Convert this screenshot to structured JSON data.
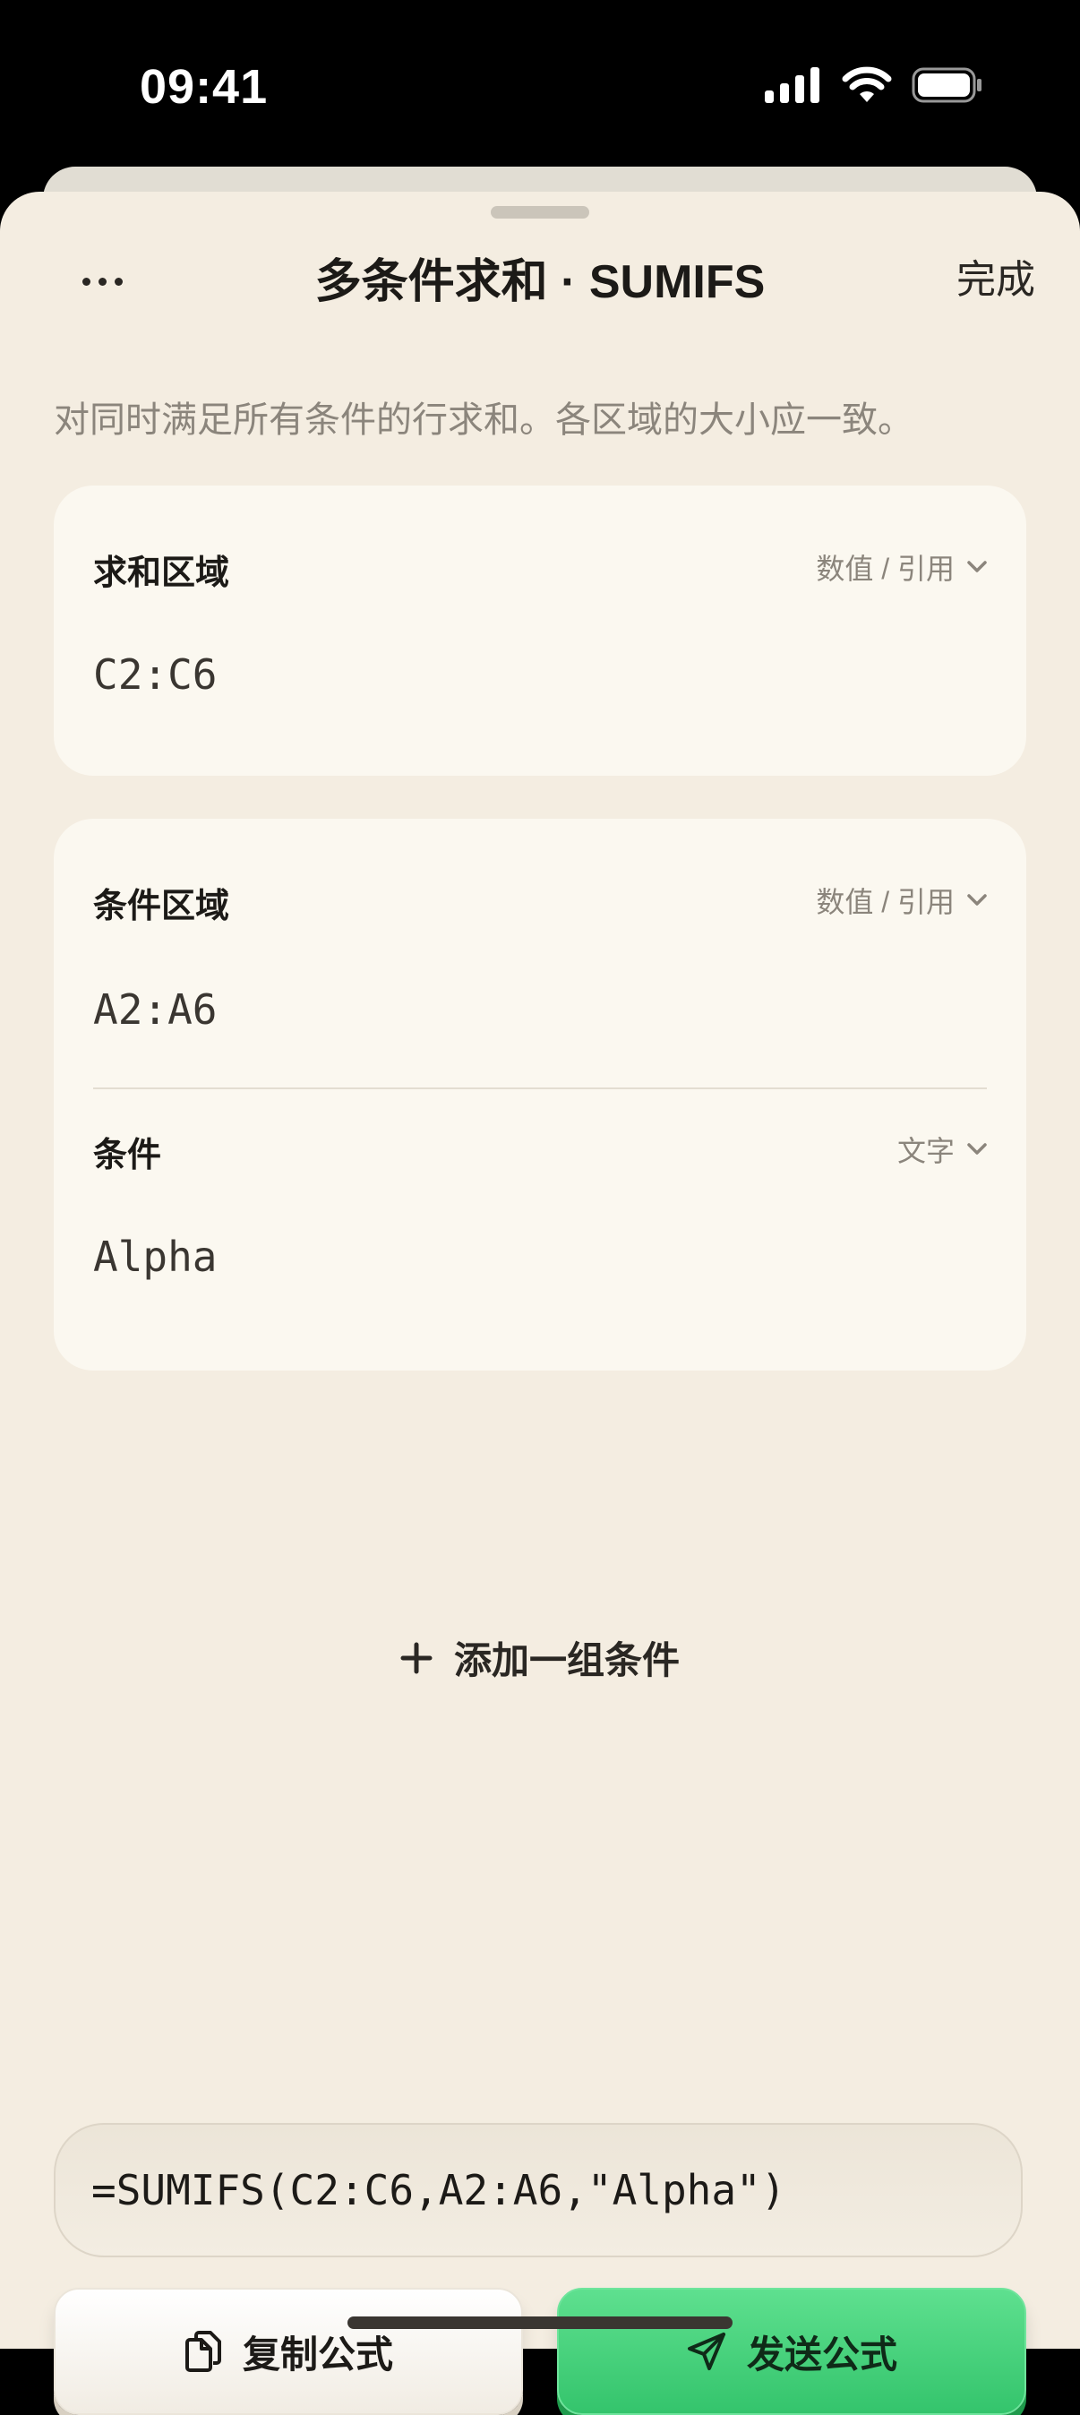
{
  "status_bar": {
    "time": "09:41"
  },
  "nav": {
    "title": "多条件求和 · SUMIFS",
    "done_label": "完成",
    "more_icon": "ellipsis-icon"
  },
  "description": "对同时满足所有条件的行求和。各区域的大小应一致。",
  "sum_range": {
    "label": "求和区域",
    "type": "数值 / 引用",
    "value": "C2:C6"
  },
  "criteria_range": {
    "label": "条件区域",
    "type": "数值 / 引用",
    "value": "A2:A6"
  },
  "criteria": {
    "label": "条件",
    "type": "文字",
    "value": "Alpha"
  },
  "add_group_label": "添加一组条件",
  "formula": "=SUMIFS(C2:C6,A2:A6,\"Alpha\")",
  "buttons": {
    "copy_label": "复制公式",
    "send_label": "发送公式"
  },
  "colors": {
    "accent_green": "#34c46c",
    "sheet_bg": "#f4ede1",
    "card_bg": "#fbf8f0"
  }
}
